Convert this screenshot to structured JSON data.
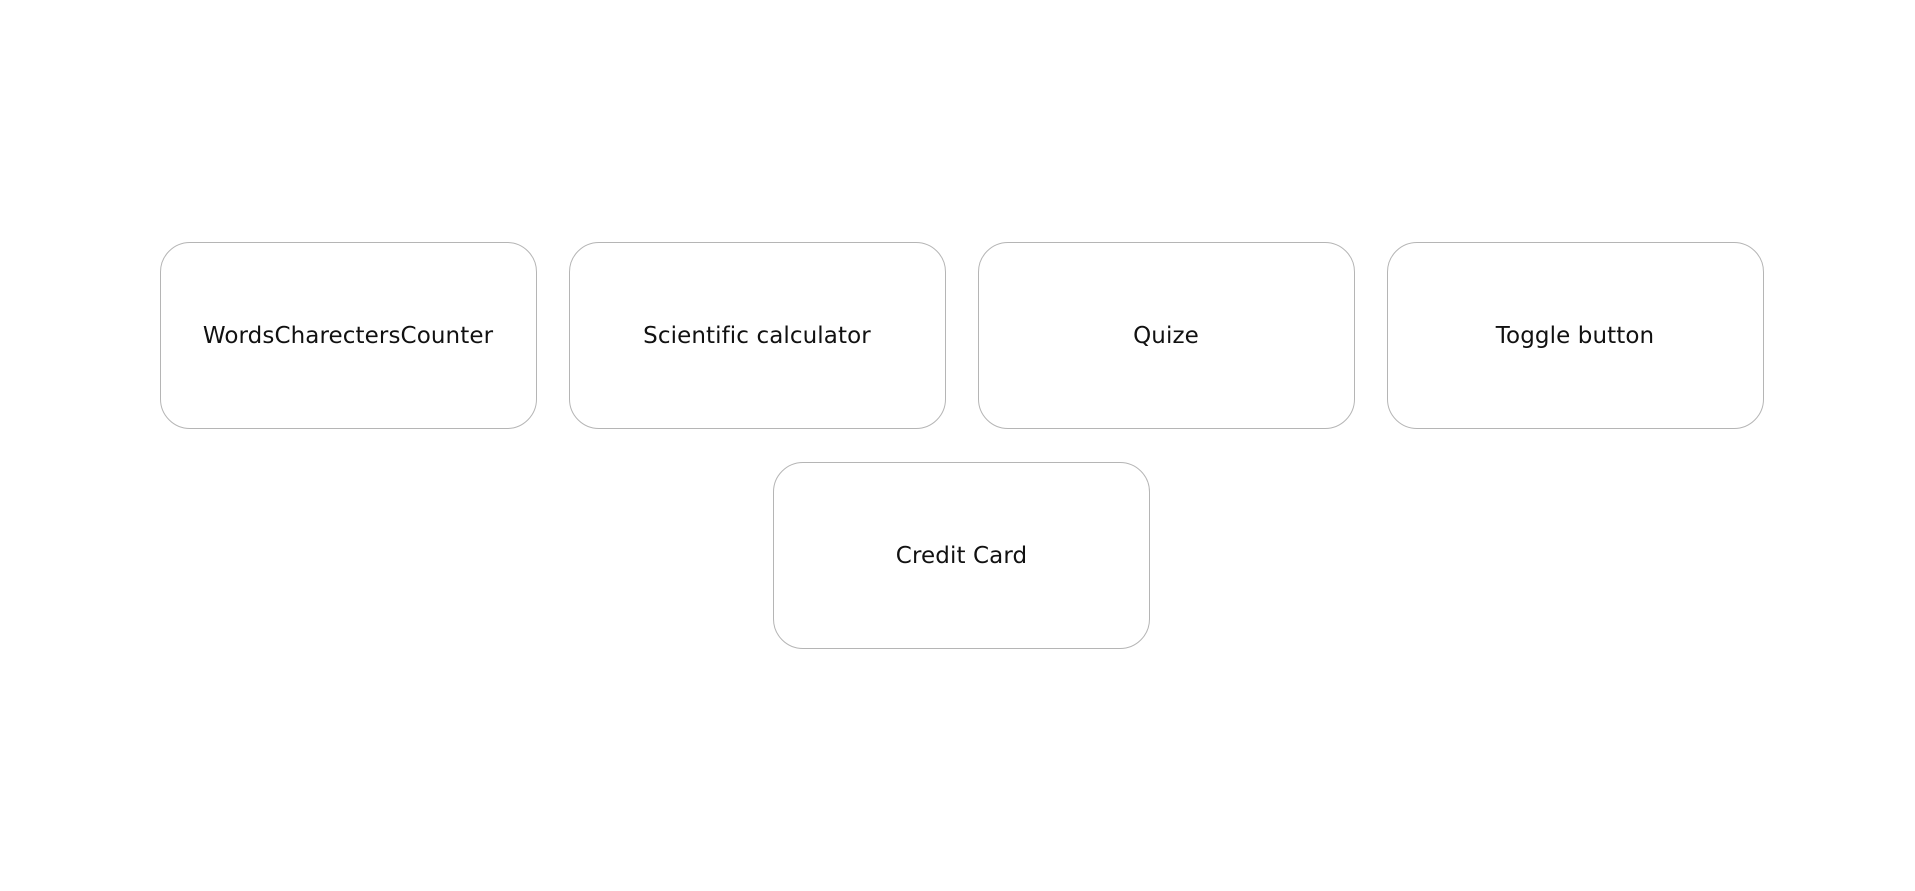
{
  "projects": {
    "cards": [
      {
        "label": "WordsCharectersCounter"
      },
      {
        "label": "Scientific calculator"
      },
      {
        "label": "Quize"
      },
      {
        "label": "Toggle button"
      },
      {
        "label": "Credit Card"
      }
    ]
  }
}
